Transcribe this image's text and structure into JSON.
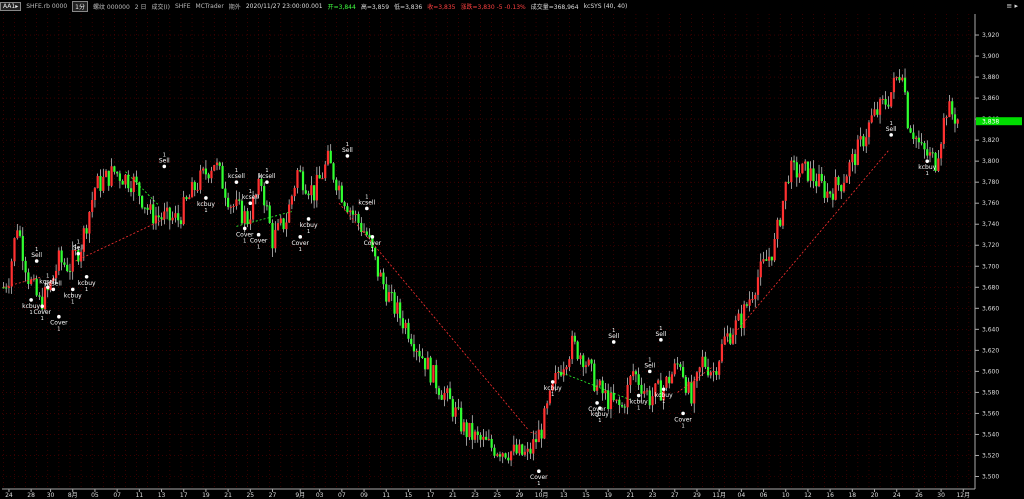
{
  "header": {
    "mode_badge": "AA1▸",
    "symbol": "SHFE.rb 0000",
    "period_badge": "1分",
    "contract": "螺纹 000000",
    "timeframe": "2 日",
    "volume_label": "成交(I)",
    "exchange": "SHFE",
    "platform": "MCTrader",
    "data_label": "期外",
    "datetime": "2020/11/27 23:00:00.001",
    "open": "开=3,844",
    "high": "高=3,859",
    "low": "低=3,836",
    "close": "收=3,835",
    "change": "涨跌=3,830 -5 -0.13%",
    "turnover": "成交量=368,964",
    "indicator": "kcSYS (40, 40)",
    "corner_icon": "≡ ▸"
  },
  "chart_data": {
    "type": "candlestick",
    "ylim": [
      3490,
      3940
    ],
    "y_ticks": [
      3500,
      3520,
      3540,
      3560,
      3580,
      3600,
      3620,
      3640,
      3660,
      3680,
      3700,
      3720,
      3740,
      3760,
      3780,
      3800,
      3820,
      3840,
      3860,
      3880,
      3900,
      3920
    ],
    "y_tick_labels": [
      "3,500",
      "3,520",
      "3,540",
      "3,560",
      "3,580",
      "3,600",
      "3,620",
      "3,640",
      "3,660",
      "3,680",
      "3,700",
      "3,720",
      "3,740",
      "3,760",
      "3,780",
      "3,800",
      "3,820",
      "3,840",
      "3,860",
      "3,880",
      "3,900",
      "3,920"
    ],
    "last_price_label": "3,838",
    "last_price": 3838,
    "colors": {
      "up": "#ff3030",
      "down": "#30ff30",
      "wick": "#ffffff",
      "grid": "#5a0000",
      "buy_line": "#ff3030",
      "sell_line": "#30ff30",
      "price_marker": "#00dd00"
    },
    "x_ticks": [
      {
        "i": 2,
        "label": "24"
      },
      {
        "i": 10,
        "label": "28"
      },
      {
        "i": 17,
        "label": "30"
      },
      {
        "i": 25,
        "label": "8月"
      },
      {
        "i": 33,
        "label": "05"
      },
      {
        "i": 41,
        "label": "07"
      },
      {
        "i": 49,
        "label": "11"
      },
      {
        "i": 57,
        "label": "13"
      },
      {
        "i": 65,
        "label": "17"
      },
      {
        "i": 73,
        "label": "19"
      },
      {
        "i": 81,
        "label": "21"
      },
      {
        "i": 89,
        "label": "25"
      },
      {
        "i": 97,
        "label": "27"
      },
      {
        "i": 107,
        "label": "9月"
      },
      {
        "i": 114,
        "label": "03"
      },
      {
        "i": 122,
        "label": "07"
      },
      {
        "i": 130,
        "label": "09"
      },
      {
        "i": 138,
        "label": "11"
      },
      {
        "i": 146,
        "label": "15"
      },
      {
        "i": 154,
        "label": "17"
      },
      {
        "i": 162,
        "label": "21"
      },
      {
        "i": 170,
        "label": "23"
      },
      {
        "i": 178,
        "label": "25"
      },
      {
        "i": 186,
        "label": "29"
      },
      {
        "i": 194,
        "label": "10月"
      },
      {
        "i": 202,
        "label": "13"
      },
      {
        "i": 210,
        "label": "15"
      },
      {
        "i": 218,
        "label": "19"
      },
      {
        "i": 226,
        "label": "21"
      },
      {
        "i": 234,
        "label": "23"
      },
      {
        "i": 242,
        "label": "27"
      },
      {
        "i": 250,
        "label": "29"
      },
      {
        "i": 258,
        "label": "11月"
      },
      {
        "i": 266,
        "label": "04"
      },
      {
        "i": 274,
        "label": "06"
      },
      {
        "i": 282,
        "label": "10"
      },
      {
        "i": 290,
        "label": "12"
      },
      {
        "i": 298,
        "label": "16"
      },
      {
        "i": 306,
        "label": "18"
      },
      {
        "i": 314,
        "label": "20"
      },
      {
        "i": 322,
        "label": "24"
      },
      {
        "i": 330,
        "label": "26"
      },
      {
        "i": 338,
        "label": "30"
      },
      {
        "i": 346,
        "label": "12月"
      }
    ],
    "bar_count": 350,
    "anchors": [
      [
        0,
        3680
      ],
      [
        2,
        3690
      ],
      [
        5,
        3740
      ],
      [
        9,
        3690
      ],
      [
        13,
        3665
      ],
      [
        16,
        3675
      ],
      [
        20,
        3705
      ],
      [
        24,
        3700
      ],
      [
        28,
        3720
      ],
      [
        33,
        3775
      ],
      [
        40,
        3790
      ],
      [
        47,
        3780
      ],
      [
        53,
        3750
      ],
      [
        59,
        3745
      ],
      [
        63,
        3745
      ],
      [
        69,
        3775
      ],
      [
        76,
        3800
      ],
      [
        82,
        3760
      ],
      [
        88,
        3745
      ],
      [
        93,
        3780
      ],
      [
        97,
        3725
      ],
      [
        102,
        3745
      ],
      [
        106,
        3790
      ],
      [
        112,
        3770
      ],
      [
        117,
        3800
      ],
      [
        122,
        3770
      ],
      [
        126,
        3750
      ],
      [
        131,
        3730
      ],
      [
        135,
        3695
      ],
      [
        140,
        3665
      ],
      [
        146,
        3640
      ],
      [
        151,
        3615
      ],
      [
        156,
        3590
      ],
      [
        161,
        3570
      ],
      [
        166,
        3545
      ],
      [
        171,
        3535
      ],
      [
        176,
        3528
      ],
      [
        181,
        3525
      ],
      [
        185,
        3522
      ],
      [
        189,
        3520
      ],
      [
        194,
        3545
      ],
      [
        200,
        3600
      ],
      [
        205,
        3625
      ],
      [
        209,
        3615
      ],
      [
        214,
        3585
      ],
      [
        219,
        3570
      ],
      [
        223,
        3565
      ],
      [
        227,
        3600
      ],
      [
        233,
        3575
      ],
      [
        238,
        3585
      ],
      [
        244,
        3610
      ],
      [
        248,
        3570
      ],
      [
        252,
        3610
      ],
      [
        256,
        3600
      ],
      [
        260,
        3630
      ],
      [
        266,
        3650
      ],
      [
        272,
        3690
      ],
      [
        278,
        3720
      ],
      [
        283,
        3790
      ],
      [
        290,
        3790
      ],
      [
        297,
        3770
      ],
      [
        302,
        3780
      ],
      [
        308,
        3810
      ],
      [
        313,
        3840
      ],
      [
        319,
        3860
      ],
      [
        324,
        3890
      ],
      [
        326,
        3840
      ],
      [
        331,
        3810
      ],
      [
        336,
        3800
      ],
      [
        340,
        3850
      ],
      [
        344,
        3840
      ]
    ],
    "trade_lines": [
      {
        "from": [
          0,
          3680
        ],
        "to": [
          14,
          3690
        ],
        "kind": "buy"
      },
      {
        "from": [
          26,
          3705
        ],
        "to": [
          58,
          3745
        ],
        "kind": "buy"
      },
      {
        "from": [
          44,
          3790
        ],
        "to": [
          56,
          3758
        ],
        "kind": "sell"
      },
      {
        "from": [
          84,
          3738
        ],
        "to": [
          104,
          3752
        ],
        "kind": "sell"
      },
      {
        "from": [
          121,
          3760
        ],
        "to": [
          189,
          3545
        ],
        "kind": "buy"
      },
      {
        "from": [
          190,
          3542
        ],
        "to": [
          194,
          3540
        ],
        "kind": "buy"
      },
      {
        "from": [
          200,
          3600
        ],
        "to": [
          226,
          3573
        ],
        "kind": "sell"
      },
      {
        "from": [
          243,
          3580
        ],
        "to": [
          256,
          3605
        ],
        "kind": "buy"
      },
      {
        "from": [
          260,
          3625
        ],
        "to": [
          319,
          3810
        ],
        "kind": "buy"
      }
    ],
    "signals": [
      {
        "i": 12,
        "price": 3705,
        "text": "Sell",
        "pos": "above"
      },
      {
        "i": 16,
        "price": 3680,
        "text": "kcsell",
        "pos": "above"
      },
      {
        "i": 10,
        "price": 3668,
        "text": "kcbuy",
        "pos": "below"
      },
      {
        "i": 18,
        "price": 3678,
        "text": "kcsell",
        "pos": "above"
      },
      {
        "i": 14,
        "price": 3662,
        "text": "Cover",
        "pos": "below"
      },
      {
        "i": 20,
        "price": 3652,
        "text": "Cover",
        "pos": "below"
      },
      {
        "i": 27,
        "price": 3712,
        "text": "Sell",
        "pos": "above"
      },
      {
        "i": 25,
        "price": 3678,
        "text": "kcbuy",
        "pos": "below"
      },
      {
        "i": 30,
        "price": 3690,
        "text": "kcbuy",
        "pos": "below"
      },
      {
        "i": 58,
        "price": 3795,
        "text": "Sell",
        "pos": "above"
      },
      {
        "i": 73,
        "price": 3765,
        "text": "kcbuy",
        "pos": "below"
      },
      {
        "i": 84,
        "price": 3780,
        "text": "kcsell",
        "pos": "above"
      },
      {
        "i": 89,
        "price": 3760,
        "text": "kcsell",
        "pos": "above"
      },
      {
        "i": 95,
        "price": 3780,
        "text": "kcsell",
        "pos": "above"
      },
      {
        "i": 87,
        "price": 3736,
        "text": "Cover",
        "pos": "below"
      },
      {
        "i": 92,
        "price": 3730,
        "text": "Cover",
        "pos": "below"
      },
      {
        "i": 110,
        "price": 3745,
        "text": "kcbuy",
        "pos": "below"
      },
      {
        "i": 107,
        "price": 3728,
        "text": "Cover",
        "pos": "below"
      },
      {
        "i": 124,
        "price": 3805,
        "text": "Sell",
        "pos": "above"
      },
      {
        "i": 131,
        "price": 3755,
        "text": "kcsell",
        "pos": "above"
      },
      {
        "i": 133,
        "price": 3728,
        "text": "Cover",
        "pos": "below"
      },
      {
        "i": 193,
        "price": 3505,
        "text": "Cover",
        "pos": "below"
      },
      {
        "i": 198,
        "price": 3590,
        "text": "kcbuy",
        "pos": "below"
      },
      {
        "i": 214,
        "price": 3570,
        "text": "Cover",
        "pos": "below"
      },
      {
        "i": 215,
        "price": 3565,
        "text": "kcbuy",
        "pos": "below"
      },
      {
        "i": 220,
        "price": 3628,
        "text": "Sell",
        "pos": "above"
      },
      {
        "i": 233,
        "price": 3600,
        "text": "Sell",
        "pos": "above"
      },
      {
        "i": 229,
        "price": 3577,
        "text": "kcbuy",
        "pos": "below"
      },
      {
        "i": 237,
        "price": 3630,
        "text": "Sell",
        "pos": "above"
      },
      {
        "i": 238,
        "price": 3583,
        "text": "kcbuy",
        "pos": "below"
      },
      {
        "i": 245,
        "price": 3560,
        "text": "Cover",
        "pos": "below"
      },
      {
        "i": 320,
        "price": 3825,
        "text": "Sell",
        "pos": "above"
      },
      {
        "i": 333,
        "price": 3800,
        "text": "kcbuy",
        "pos": "below"
      }
    ]
  }
}
